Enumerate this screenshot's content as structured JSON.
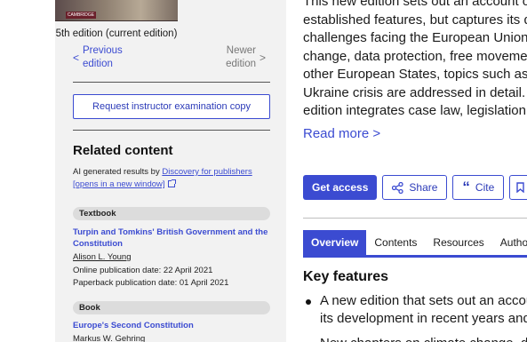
{
  "book": {
    "cover_brand": "CAMBRIDGE",
    "edition_current": "5th edition (current edition)",
    "previous_edition": "Previous edition",
    "newer_edition": "Newer edition",
    "request_copy_label": "Request instructor examination copy"
  },
  "related": {
    "title": "Related content",
    "ai_prefix": "AI generated results by ",
    "ai_link": "Discovery for publishers [opens in a new window]",
    "items": [
      {
        "type": "Textbook",
        "title": "Turpin and Tomkins' British Government and the Constitution",
        "author": "Alison L. Young",
        "online_date": "Online publication date: 22 April 2021",
        "paperback_date": "Paperback publication date: 01 April 2021"
      },
      {
        "type": "Book",
        "title": "Europe's Second Constitution",
        "author": "Markus W. Gehring"
      }
    ]
  },
  "description": {
    "lines": [
      "This new edition sets out an account of",
      "established features, but captures its d",
      "challenges facing the European Union.",
      "change, data protection, free movemen",
      "other European States, topics such as t",
      "Ukraine crisis are addressed in detail. A",
      "edition integrates case law, legislation,"
    ],
    "read_more": "Read more >"
  },
  "actions": {
    "get_access": "Get access",
    "share": "Share",
    "cite": "Cite"
  },
  "tabs": [
    "Overview",
    "Contents",
    "Resources",
    "Authors"
  ],
  "key_features": {
    "title": "Key features",
    "items": [
      "A new edition that sets out an accou",
      "its development in recent years and",
      "New chapters on climate change, da"
    ]
  },
  "colors": {
    "accent": "#3b4bd1",
    "sidebar_bg": "#f2f2f2"
  }
}
